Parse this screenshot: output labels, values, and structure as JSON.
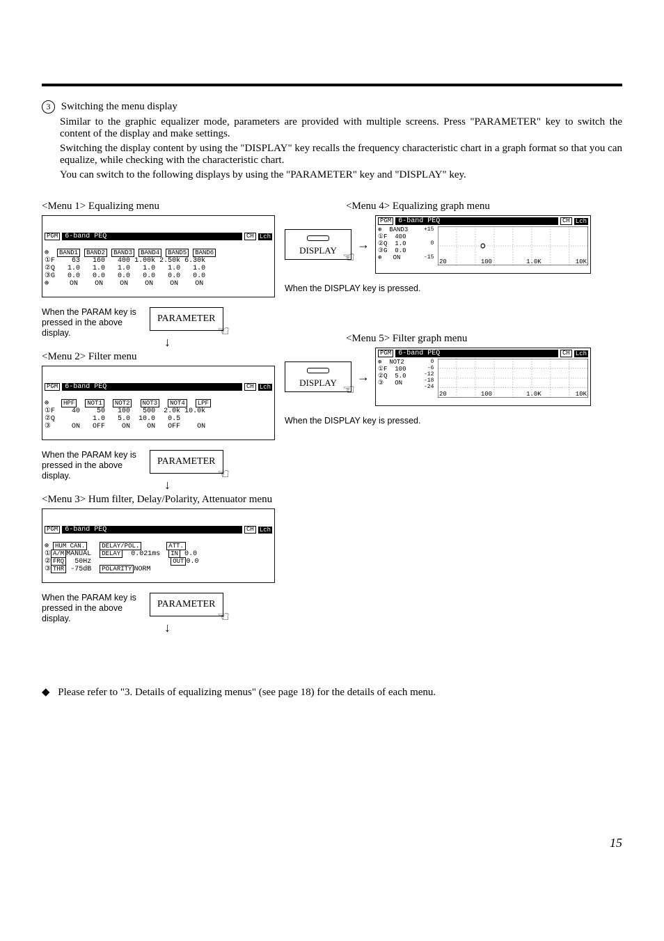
{
  "header": {
    "step_number": "3",
    "step_title": "Switching the menu display",
    "paragraphs": [
      "Similar to the graphic equalizer mode, parameters are provided with multiple screens. Press \"PARAMETER\" key to switch the content of the display and make settings.",
      "Switching the display content by using the \"DISPLAY\" key recalls the frequency characteristic chart in a graph format so that you can equalize, while checking with the characteristic chart.",
      "You can switch to the following displays by using the \"PARAMETER\" key and \"DISPLAY\" key."
    ]
  },
  "menu1": {
    "label": "<Menu 1> Equalizing menu",
    "lcd": {
      "pgm": "PGM",
      "title": "6-band PEQ",
      "ch": "CH",
      "chval": "Lch",
      "headers": [
        "BAND1",
        "BAND2",
        "BAND3",
        "BAND4",
        "BAND5",
        "BAND6"
      ],
      "sidetags": [
        "①",
        "②",
        "③",
        "",
        "F",
        "Q",
        "G"
      ],
      "rows": [
        [
          "63",
          "160",
          "400",
          "1.00k",
          "2.50k",
          "6.30k"
        ],
        [
          "1.0",
          "1.0",
          "1.0",
          "1.0",
          "1.0",
          "1.0"
        ],
        [
          "0.0",
          "0.0",
          "0.0",
          "0.0",
          "0.0",
          "0.0"
        ],
        [
          "ON",
          "ON",
          "ON",
          "ON",
          "ON",
          "ON"
        ]
      ]
    },
    "note": "When the PARAM key is pressed in the above display.",
    "btn": "PARAMETER"
  },
  "menu2": {
    "label": "<Menu 2> Filter menu",
    "lcd": {
      "pgm": "PGM",
      "title": "6-band PEQ",
      "ch": "CH",
      "chval": "Lch",
      "headers": [
        "HPF",
        "NOT1",
        "NOT2",
        "NOT3",
        "NOT4",
        "LPF"
      ],
      "sidetags": [
        "①",
        "②",
        "③",
        "",
        "F",
        "Q",
        ""
      ],
      "rows": [
        [
          "40",
          "50",
          "100",
          "500",
          "2.0k",
          "10.0k"
        ],
        [
          "",
          "1.0",
          "5.0",
          "10.0",
          "0.5",
          ""
        ],
        [
          "ON",
          "OFF",
          "ON",
          "ON",
          "OFF",
          "ON"
        ]
      ]
    },
    "note": "When the PARAM key is pressed in the above display.",
    "btn": "PARAMETER"
  },
  "menu3": {
    "label": "<Menu 3> Hum filter, Delay/Polarity, Attenuator menu",
    "lcd": {
      "pgm": "PGM",
      "title": "6-band PEQ",
      "ch": "CH",
      "chval": "Lch",
      "col1_header": "HUM CAN.",
      "col2_header": "DELAY/POL.",
      "col3_header": "ATT.",
      "rows_left": [
        [
          "①",
          "A/M",
          "MANUAL"
        ],
        [
          "②",
          "FRQ",
          "50Hz"
        ],
        [
          "③",
          "THR",
          "-75dB"
        ]
      ],
      "rows_mid": [
        [
          "DELAY",
          "0.021ms"
        ],
        [
          "POLARITY",
          "NORM"
        ]
      ],
      "rows_right": [
        [
          "IN",
          "0.0"
        ],
        [
          "OUT",
          "0.0"
        ]
      ]
    },
    "note": "When the PARAM key is pressed in the above display.",
    "btn": "PARAMETER"
  },
  "menu4": {
    "label": "<Menu 4> Equalizing graph menu",
    "display_btn": "DISPLAY",
    "lcd": {
      "pgm": "PGM",
      "title": "6-band PEQ",
      "ch": "CH",
      "chval": "Lch",
      "side_rows": [
        "BAND3",
        "400",
        "1.0",
        "0.0",
        "ON"
      ],
      "sidetags": [
        "①",
        "②",
        "③",
        "",
        "F",
        "Q",
        "G"
      ],
      "y_top": "+15",
      "y_mid": "0",
      "y_bot": "-15",
      "x_labels": [
        "20",
        "100",
        "1.0K",
        "10K"
      ]
    },
    "note": "When the DISPLAY key is pressed."
  },
  "menu5": {
    "label": "<Menu 5> Filter graph menu",
    "display_btn": "DISPLAY",
    "lcd": {
      "pgm": "PGM",
      "title": "6-band PEQ",
      "ch": "CH",
      "chval": "Lch",
      "side_rows": [
        "NOT2",
        "100",
        "5.0",
        "ON"
      ],
      "sidetags": [
        "①",
        "②",
        "③",
        "",
        "F",
        "Q",
        ""
      ],
      "y_labels": [
        "0",
        "-6",
        "-12",
        "-18",
        "-24"
      ],
      "x_labels": [
        "20",
        "100",
        "1.0K",
        "10K"
      ]
    },
    "note": "When the DISPLAY key is pressed."
  },
  "footer": {
    "bullet": "◆",
    "text": "Please refer to \"3. Details of equalizing menus\" (see page 18) for the details of each menu."
  },
  "page_number": "15"
}
